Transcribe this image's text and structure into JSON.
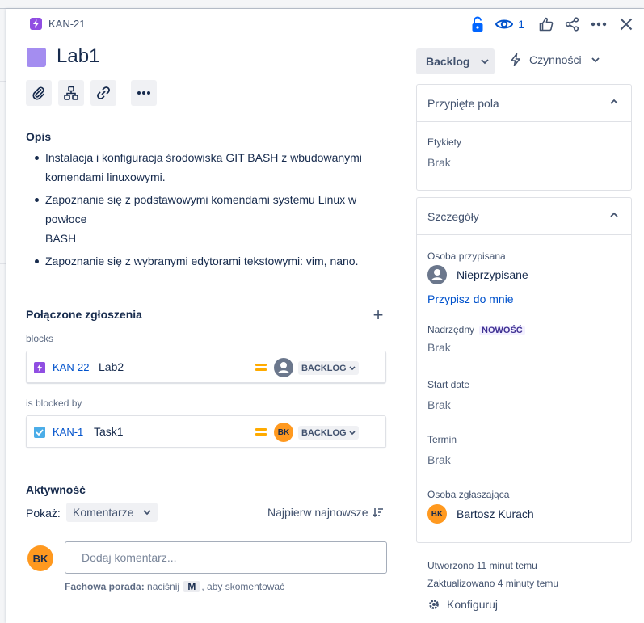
{
  "header": {
    "issue_key": "KAN-21",
    "watch_count": "1"
  },
  "issue": {
    "title": "Lab1"
  },
  "description": {
    "heading": "Opis",
    "items": [
      "Instalacja i konfiguracja środowiska GIT BASH z wbudowanymi komendami linuxowymi.",
      "Zapoznanie się z podstawowymi komendami systemu Linux w powłoce",
      "Zapoznanie się z wybranymi edytorami tekstowymi: vim, nano."
    ],
    "item2_cont": "BASH"
  },
  "linked": {
    "heading": "Połączone zgłoszenia",
    "groups": [
      {
        "type": "blocks",
        "key": "KAN-22",
        "summary": "Lab2",
        "status": "BACKLOG"
      },
      {
        "type": "is blocked by",
        "key": "KAN-1",
        "summary": "Task1",
        "status": "BACKLOG",
        "assignee_initials": "BK"
      }
    ]
  },
  "activity": {
    "heading": "Aktywność",
    "show_label": "Pokaż:",
    "filter": "Komentarze",
    "sort": "Najpierw najnowsze",
    "user_initials": "BK",
    "comment_placeholder": "Dodaj komentarz...",
    "tip_bold": "Fachowa porada:",
    "tip_pre": " naciśnij ",
    "tip_key": "M",
    "tip_post": ", aby skomentować"
  },
  "sidebar": {
    "status": "Backlog",
    "actions": "Czynności",
    "pinned": {
      "title": "Przypięte pola",
      "label_field": "Etykiety",
      "label_value": "Brak"
    },
    "details": {
      "title": "Szczegóły",
      "assignee_label": "Osoba przypisana",
      "assignee_value": "Nieprzypisane",
      "assign_me": "Przypisz do mnie",
      "parent_label": "Nadrzędny",
      "parent_badge": "NOWOŚĆ",
      "parent_value": "Brak",
      "start_label": "Start date",
      "start_value": "Brak",
      "due_label": "Termin",
      "due_value": "Brak",
      "reporter_label": "Osoba zgłaszająca",
      "reporter_initials": "BK",
      "reporter_value": "Bartosz Kurach"
    },
    "created": "Utworzono 11 minut temu",
    "updated": "Zaktualizowano 4 minuty temu",
    "configure": "Konfiguruj"
  },
  "colors": {
    "accent": "#0052cc",
    "epic_purple": "#904ee2",
    "priority_medium": "#ffab00",
    "avatar_orange": "#ff991f"
  }
}
